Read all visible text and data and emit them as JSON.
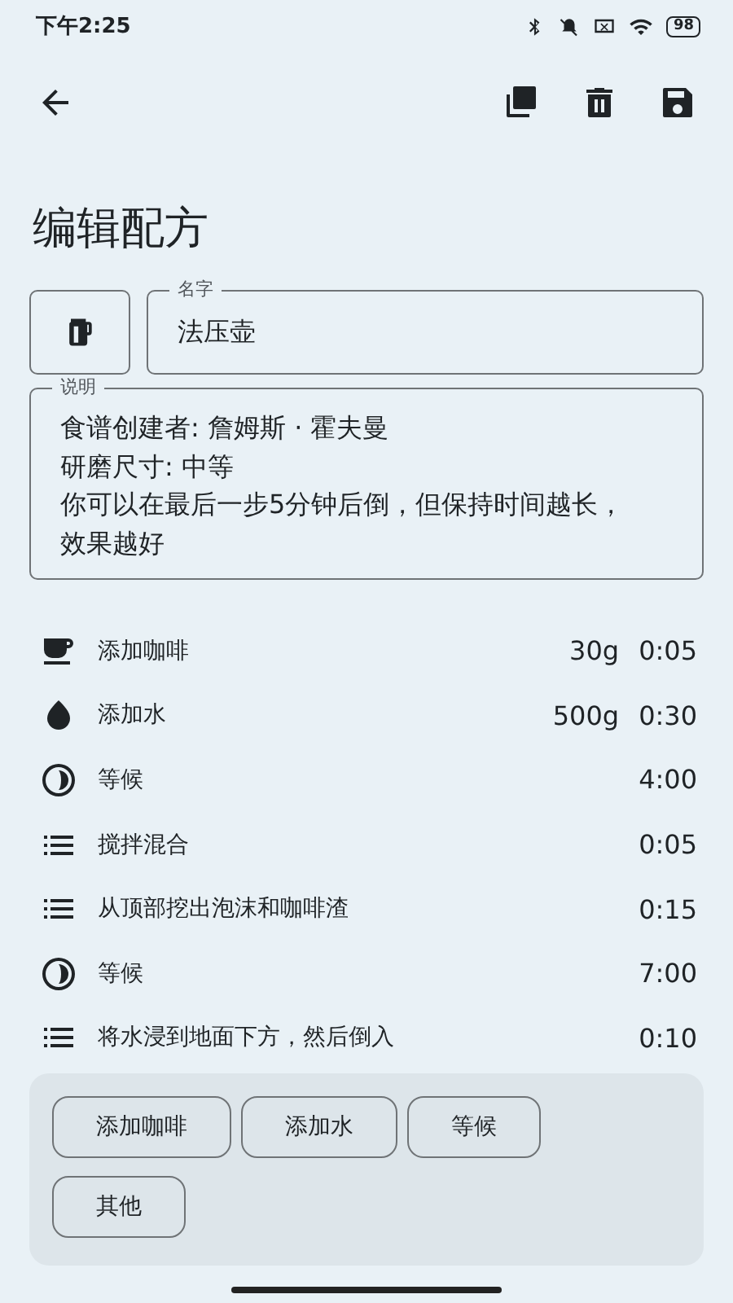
{
  "status_bar": {
    "time": "下午2:25",
    "battery": "98"
  },
  "title": "编辑配方",
  "name_field": {
    "label": "名字",
    "value": "法压壶"
  },
  "description_field": {
    "label": "说明",
    "lines": [
      "食谱创建者: 詹姆斯 · 霍夫曼",
      "研磨尺寸: 中等",
      "你可以在最后一步5分钟后倒，但保持时间越长，效果越好"
    ]
  },
  "steps": [
    {
      "kind": "coffee",
      "label": "添加咖啡",
      "amount": "30g",
      "time": "0:05"
    },
    {
      "kind": "water",
      "label": "添加水",
      "amount": "500g",
      "time": "0:30"
    },
    {
      "kind": "wait",
      "label": "等候",
      "time": "4:00"
    },
    {
      "kind": "stir",
      "label": "搅拌混合",
      "time": "0:05"
    },
    {
      "kind": "stir",
      "label": "从顶部挖出泡沫和咖啡渣",
      "time": "0:15"
    },
    {
      "kind": "wait",
      "label": "等候",
      "time": "7:00"
    },
    {
      "kind": "stir",
      "label": "将水浸到地面下方，然后倒入",
      "time": "0:10"
    }
  ],
  "add_buttons": [
    "添加咖啡",
    "添加水",
    "等候",
    "其他"
  ]
}
